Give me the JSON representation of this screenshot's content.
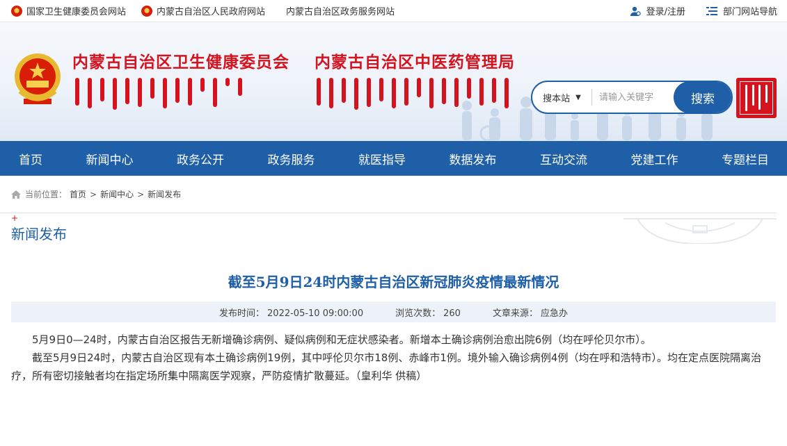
{
  "topbar": {
    "links": [
      {
        "label": "国家卫生健康委员会网站",
        "emblem": true
      },
      {
        "label": "内蒙古自治区人民政府网站",
        "emblem": true
      },
      {
        "label": "内蒙古自治区政务服务网站",
        "emblem": false
      }
    ],
    "login": "登录/注册",
    "dept_nav": "部门网站导航"
  },
  "header": {
    "title_1": "内蒙古自治区卫生健康委员会",
    "title_2": "内蒙古自治区中医药管理局",
    "search": {
      "scope": "搜本站",
      "placeholder": "请输入关键字",
      "button": "搜索"
    }
  },
  "nav": [
    "首页",
    "新闻中心",
    "政务公开",
    "政务服务",
    "就医指导",
    "数据发布",
    "互动交流",
    "党建工作",
    "专题栏目"
  ],
  "breadcrumb": {
    "label": "当前位置：",
    "items": [
      "首页",
      "新闻中心",
      "新闻发布"
    ]
  },
  "section": {
    "plus": "+",
    "title": "新闻发布"
  },
  "article": {
    "title": "截至5月9日24时内蒙古自治区新冠肺炎疫情最新情况",
    "publish_label": "发布时间：",
    "publish_time": "2022-05-10 09:00:00",
    "views_label": "浏览次数：",
    "views": "260",
    "source_label": "文章来源：",
    "source": "应急办",
    "paragraphs": [
      "5月9日0—24时，内蒙古自治区报告无新增确诊病例、疑似病例和无症状感染者。新增本土确诊病例治愈出院6例（均在呼伦贝尔市）。",
      "截至5月9日24时，内蒙古自治区现有本土确诊病例19例，其中呼伦贝尔市18例、赤峰市1例。境外输入确诊病例4例（均在呼和浩特市）。均在定点医院隔离治疗，所有密切接触者均在指定场所集中隔离医学观察，严防疫情扩散蔓延。（皇利华 供稿）"
    ]
  },
  "colors": {
    "primary": "#1e5fa8",
    "red": "#d4131e",
    "meta_bg": "#edf2f8"
  }
}
